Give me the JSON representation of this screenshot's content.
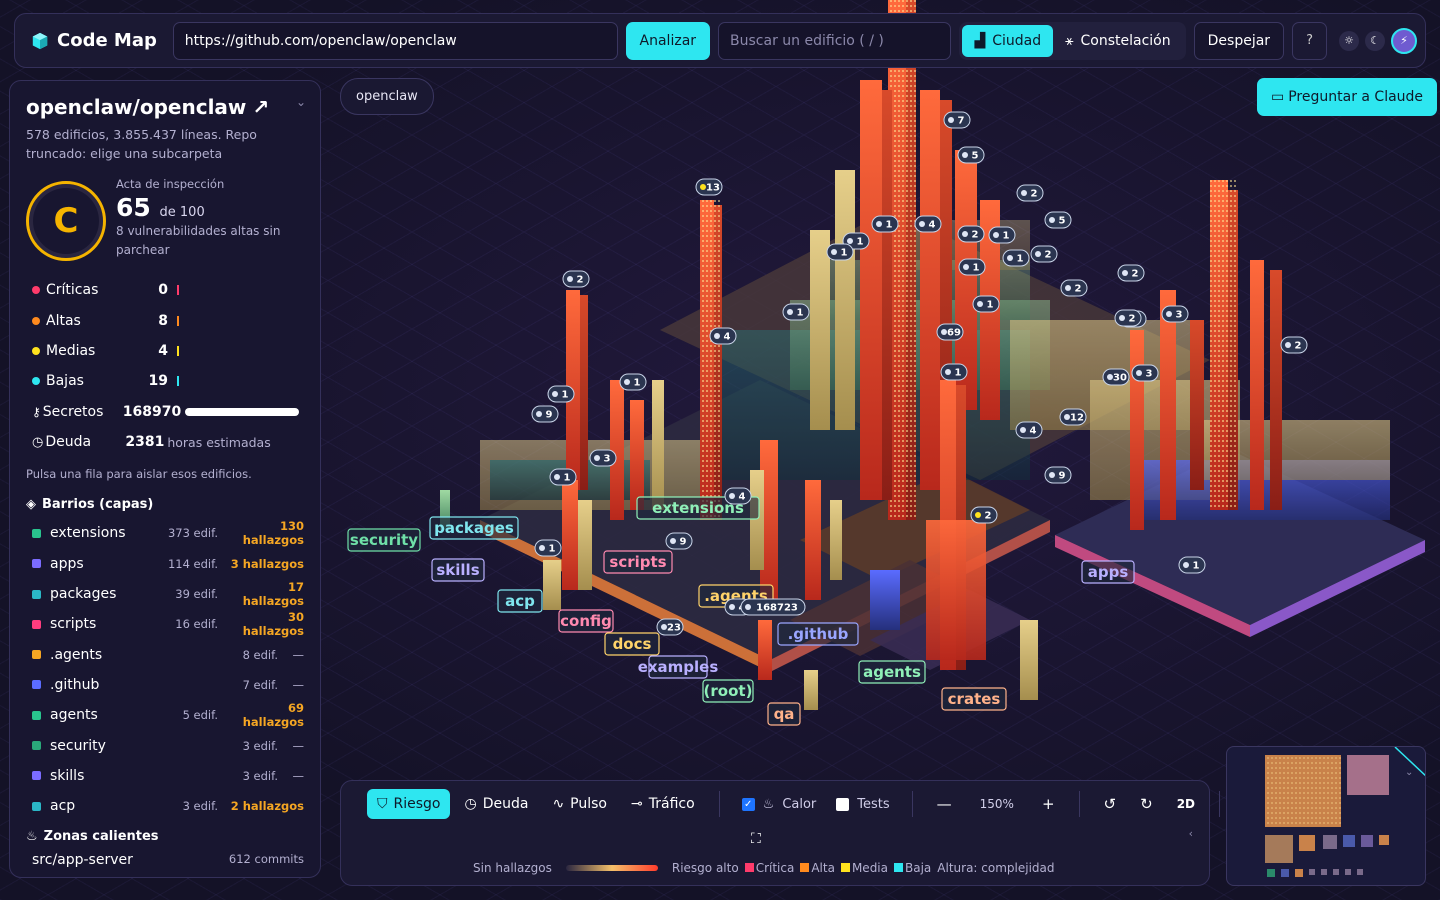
{
  "app": {
    "title": "Code Map"
  },
  "topbar": {
    "url_value": "https://github.com/openclaw/openclaw",
    "analyze_label": "Analizar",
    "search_placeholder": "Buscar un edificio ( / )",
    "view_city": "Ciudad",
    "view_constellation": "Constelación",
    "clear_label": "Despejar"
  },
  "repo": {
    "name": "openclaw/openclaw",
    "summary": "578 edificios, 3.855.437 líneas. Repo truncado: elige una subcarpeta"
  },
  "inspection": {
    "label": "Acta de inspección",
    "grade": "C",
    "score": "65",
    "out_of": "de 100",
    "note": "8 vulnerabilidades altas sin parchear"
  },
  "severities": [
    {
      "name": "Críticas",
      "count": "0",
      "color": "#ff3b6b"
    },
    {
      "name": "Altas",
      "count": "8",
      "color": "#ff8a1e"
    },
    {
      "name": "Medias",
      "count": "4",
      "color": "#ffe21e"
    },
    {
      "name": "Bajas",
      "count": "19",
      "color": "#2ee6f0"
    }
  ],
  "secrets": {
    "label": "Secretos",
    "count": "168970"
  },
  "debt": {
    "label": "Deuda",
    "count": "2381",
    "unit": "horas estimadas"
  },
  "hint": "Pulsa una fila para aislar esos edificios.",
  "districts_title": "Barrios (capas)",
  "districts": [
    {
      "name": "extensions",
      "buildings": "373 edif.",
      "findings": "130 hallazgos",
      "color": "#29c48e"
    },
    {
      "name": "apps",
      "buildings": "114 edif.",
      "findings": "3 hallazgos",
      "color": "#7b6cff"
    },
    {
      "name": "packages",
      "buildings": "39 edif.",
      "findings": "17 hallazgos",
      "color": "#2bb7c7"
    },
    {
      "name": "scripts",
      "buildings": "16 edif.",
      "findings": "30 hallazgos",
      "color": "#ff3d7f"
    },
    {
      "name": ".agents",
      "buildings": "8 edif.",
      "findings": "—",
      "color": "#f5a623"
    },
    {
      "name": ".github",
      "buildings": "7 edif.",
      "findings": "—",
      "color": "#5b6cff"
    },
    {
      "name": "agents",
      "buildings": "5 edif.",
      "findings": "69 hallazgos",
      "color": "#29c48e"
    },
    {
      "name": "security",
      "buildings": "3 edif.",
      "findings": "—",
      "color": "#2aa87a"
    },
    {
      "name": "skills",
      "buildings": "3 edif.",
      "findings": "—",
      "color": "#7b6cff"
    },
    {
      "name": "acp",
      "buildings": "3 edif.",
      "findings": "2 hallazgos",
      "color": "#2bb7c7"
    }
  ],
  "hotzones_title": "Zonas calientes",
  "hotzone": {
    "path": "src/app-server",
    "commits": "612 commits"
  },
  "breadcrumb": "openclaw",
  "ask_label": "Preguntar a Claude",
  "city_labels": [
    {
      "text": "security",
      "color": "#6fe0a8"
    },
    {
      "text": "packages",
      "color": "#7fe6ee"
    },
    {
      "text": "skills",
      "color": "#b9b0ff"
    },
    {
      "text": "acp",
      "color": "#7fe6ee"
    },
    {
      "text": "extensions",
      "color": "#8ff0b8"
    },
    {
      "text": "scripts",
      "color": "#ff8ab0"
    },
    {
      "text": "config",
      "color": "#ff8ab0"
    },
    {
      "text": "docs",
      "color": "#ffd36a"
    },
    {
      "text": "examples",
      "color": "#b9b0ff"
    },
    {
      "text": "(root)",
      "color": "#8ff0b8"
    },
    {
      "text": "qa",
      "color": "#ffb28a"
    },
    {
      "text": ".agents",
      "color": "#ffd36a"
    },
    {
      "text": ".github",
      "color": "#9aa6ff"
    },
    {
      "text": "agents",
      "color": "#8ff0b8"
    },
    {
      "text": "crates",
      "color": "#ffb28a"
    },
    {
      "text": "apps",
      "color": "#b9b0ff"
    }
  ],
  "badges": [
    "7",
    "5",
    "13",
    "2",
    "2",
    "5",
    "1",
    "4",
    "2",
    "1",
    "1",
    "1",
    "1",
    "2",
    "1",
    "2",
    "1",
    "2",
    "4",
    "1",
    "3",
    "1",
    "1",
    "69",
    "2",
    "9",
    "1",
    "1",
    "3",
    "30",
    "3",
    "2",
    "12",
    "4",
    "3",
    "9",
    "1",
    "2",
    "4",
    "9",
    "1",
    "23",
    "4",
    "168723",
    "1"
  ],
  "toolbar": {
    "modes": [
      "Riesgo",
      "Deuda",
      "Pulso",
      "Tráfico"
    ],
    "heat_label": "Calor",
    "tests_label": "Tests",
    "zoom": "150%",
    "view2d": "2D"
  },
  "legend": {
    "none": "Sin hallazgos",
    "high": "Riesgo alto",
    "critical": "Crítica",
    "high_sev": "Alta",
    "medium": "Media",
    "low": "Baja",
    "height": "Altura: complejidad"
  }
}
